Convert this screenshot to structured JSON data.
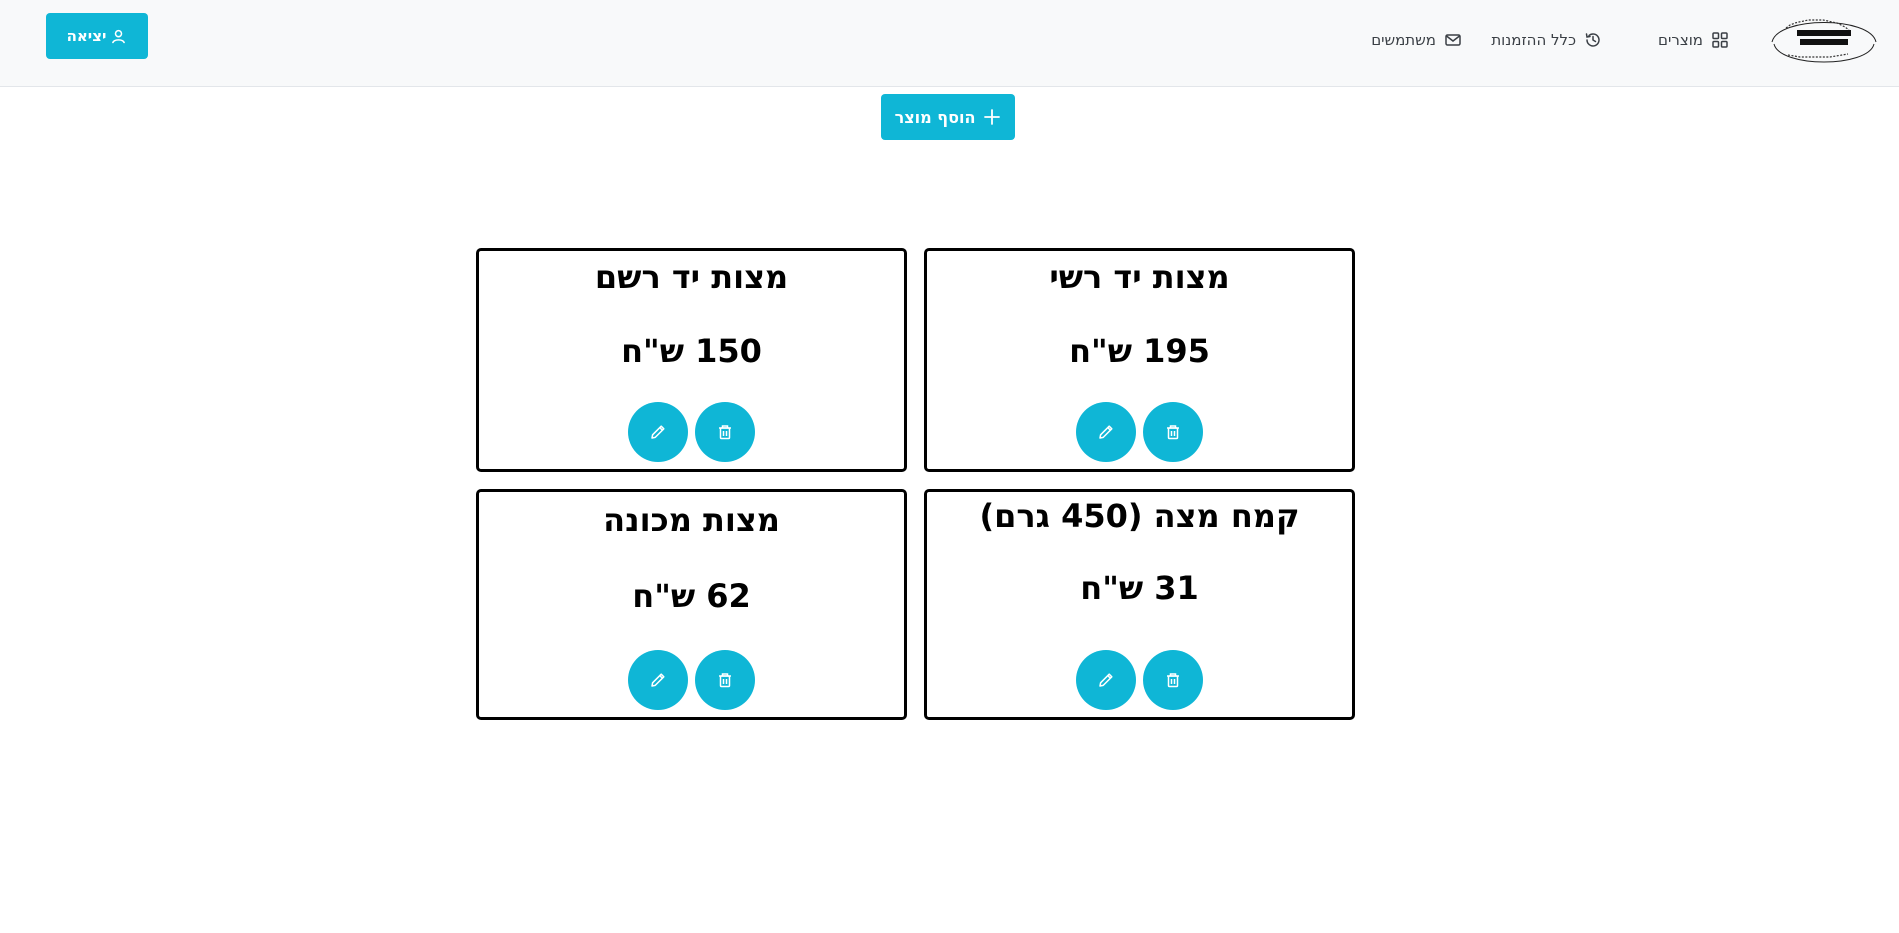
{
  "logo": {
    "arc_text": "בנשיאות מורינו מרא דאתרא",
    "line1": "מצות חבורה",
    "line2": "רמת אשכול",
    "bottom_text": "הגה\"צ צבי שולזין שליט\"א"
  },
  "nav": {
    "products_label": "מוצרים",
    "orders_label": "כלל ההזמנות",
    "users_label": "משתמשים"
  },
  "header": {
    "logout_label": "יציאה"
  },
  "main": {
    "add_product_label": "הוסף מוצר"
  },
  "products": [
    {
      "name": "מצות יד רשי",
      "price": "195 ש\"ח"
    },
    {
      "name": "מצות יד רשם",
      "price": "150 ש\"ח"
    },
    {
      "name": "קמח מצה (450 גרם)",
      "price": "31 ש\"ח"
    },
    {
      "name": "מצות מכונה",
      "price": "62 ש\"ח"
    }
  ],
  "colors": {
    "accent": "#0fb6d6",
    "topbar_bg": "#f8f9fa",
    "card_border": "#000000"
  },
  "icons": {
    "products": "grid-icon",
    "orders": "history-icon",
    "users": "envelope-icon",
    "logout": "user-icon",
    "add": "plus-icon",
    "edit": "pencil-icon",
    "delete": "trash-icon"
  }
}
